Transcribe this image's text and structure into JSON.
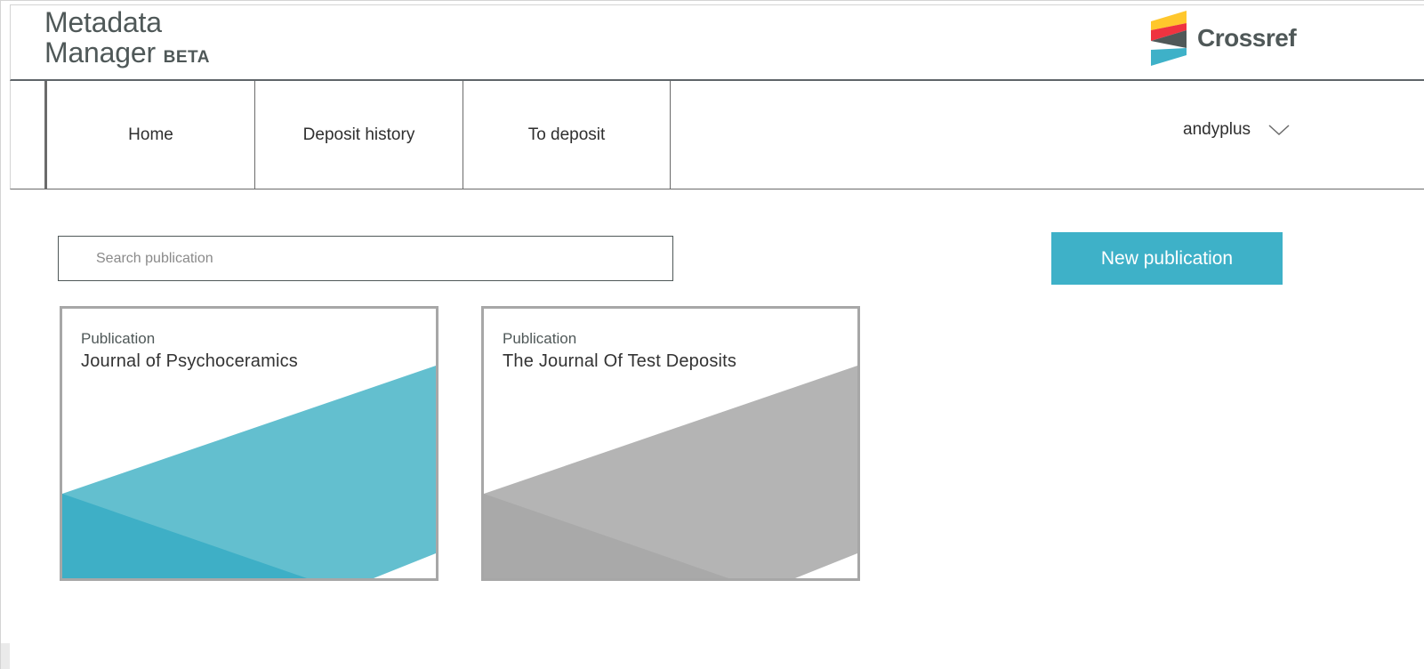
{
  "header": {
    "app_name_line1": "Metadata",
    "app_name_line2": "Manager",
    "beta_label": "BETA",
    "logo_text": "Crossref"
  },
  "nav": {
    "tabs": [
      {
        "label": "Home"
      },
      {
        "label": "Deposit history"
      },
      {
        "label": "To deposit"
      }
    ],
    "user": {
      "name": "andyplus",
      "icon": "chevron-down-icon"
    }
  },
  "search": {
    "placeholder": "Search publication",
    "value": ""
  },
  "actions": {
    "new_publication_label": "New publication"
  },
  "publications": [
    {
      "type": "Publication",
      "title": "Journal of Psychoceramics",
      "theme": "teal"
    },
    {
      "type": "Publication",
      "title": "The Journal Of Test Deposits",
      "theme": "gray"
    }
  ],
  "colors": {
    "accent": "#3eb1c8",
    "teal_light": "#63bfcf",
    "teal_dark": "#3eafc6",
    "gray_light": "#b4b4b4",
    "gray_dark": "#a9a9a9",
    "logo_yellow": "#ffc72c",
    "logo_red": "#ef3340",
    "logo_gray": "#4f5858",
    "logo_blue": "#3eb1c8"
  }
}
